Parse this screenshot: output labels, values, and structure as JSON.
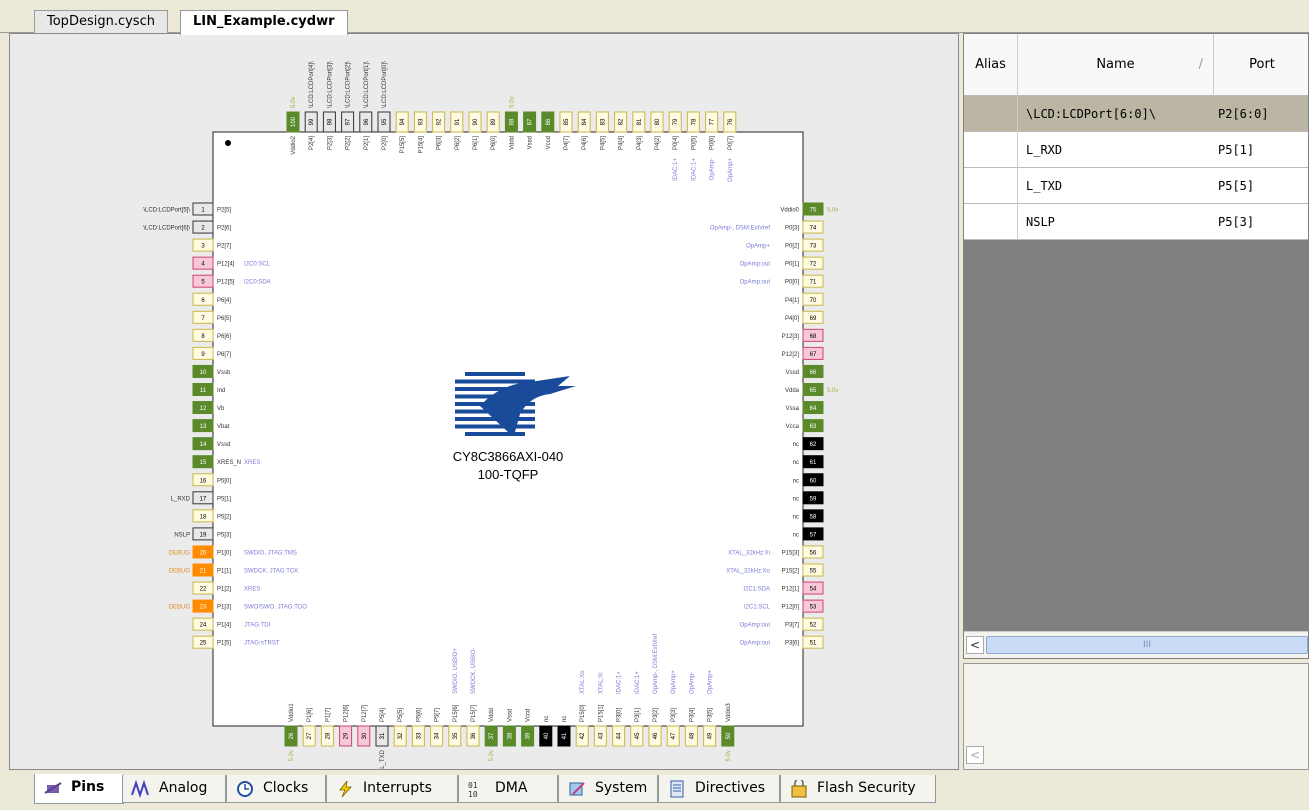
{
  "file_tabs": [
    {
      "label": "TopDesign.cysch"
    },
    {
      "label": "LIN_Example.cydwr"
    }
  ],
  "chip": {
    "part": "CY8C3866AXI-040",
    "package": "100-TQFP",
    "colors": {
      "plain": "#fffbe0",
      "plain_border": "#c9b74a",
      "supply": "#5a8a2a",
      "black": "#000000",
      "orange": "#ff8c00",
      "pink": "#f8c8d8",
      "pink_border": "#d0407a",
      "boxed": "#e8e8e8",
      "boxed_border": "#333333"
    }
  },
  "pins": {
    "left": [
      {
        "n": "1",
        "name": "P2[5]",
        "ext": "\\LCD:LCDPort[5]\\",
        "type": "boxed"
      },
      {
        "n": "2",
        "name": "P2[6]",
        "ext": "\\LCD:LCDPort[6]\\",
        "type": "boxed"
      },
      {
        "n": "3",
        "name": "P2[7]",
        "type": "plain"
      },
      {
        "n": "4",
        "name": "P12[4]",
        "fn": "I2C0:SCL",
        "type": "pink"
      },
      {
        "n": "5",
        "name": "P12[5]",
        "fn": "I2C0:SDA",
        "type": "pink"
      },
      {
        "n": "6",
        "name": "P6[4]",
        "type": "plain"
      },
      {
        "n": "7",
        "name": "P6[5]",
        "type": "plain"
      },
      {
        "n": "8",
        "name": "P6[6]",
        "type": "plain"
      },
      {
        "n": "9",
        "name": "P6[7]",
        "type": "plain"
      },
      {
        "n": "10",
        "name": "Vssb",
        "type": "supply"
      },
      {
        "n": "11",
        "name": "Ind",
        "type": "supply"
      },
      {
        "n": "12",
        "name": "Vb",
        "type": "supply"
      },
      {
        "n": "13",
        "name": "Vbat",
        "type": "supply"
      },
      {
        "n": "14",
        "name": "Vssd",
        "type": "supply"
      },
      {
        "n": "15",
        "name": "XRES_N",
        "fn": "XRES",
        "type": "supply"
      },
      {
        "n": "16",
        "name": "P5[0]",
        "type": "plain"
      },
      {
        "n": "17",
        "name": "P5[1]",
        "ext": "L_RXD",
        "type": "boxed"
      },
      {
        "n": "18",
        "name": "P5[2]",
        "type": "plain"
      },
      {
        "n": "19",
        "name": "P5[3]",
        "ext": "NSLP",
        "type": "boxed"
      },
      {
        "n": "20",
        "name": "P1[0]",
        "fn": "SWDIO, JTAG:TMS",
        "ext": "DEBUG",
        "type": "orange"
      },
      {
        "n": "21",
        "name": "P1[1]",
        "fn": "SWDCK, JTAG:TCK",
        "ext": "DEBUG",
        "type": "orange"
      },
      {
        "n": "22",
        "name": "P1[2]",
        "fn": "XRES",
        "type": "plain"
      },
      {
        "n": "23",
        "name": "P1[3]",
        "fn": "SWO/SWO, JTAG:TDO",
        "ext": "DEBUG",
        "type": "orange"
      },
      {
        "n": "24",
        "name": "P1[4]",
        "fn": "JTAG:TDI",
        "type": "plain"
      },
      {
        "n": "25",
        "name": "P1[5]",
        "fn": "JTAG:nTRST",
        "type": "plain"
      }
    ],
    "bottom": [
      {
        "n": "26",
        "name": "Vddio1",
        "type": "supply",
        "v": "5.0v"
      },
      {
        "n": "27",
        "name": "P1[6]",
        "type": "plain"
      },
      {
        "n": "28",
        "name": "P1[7]",
        "type": "plain"
      },
      {
        "n": "29",
        "name": "P12[6]",
        "type": "pink"
      },
      {
        "n": "30",
        "name": "P12[7]",
        "type": "pink"
      },
      {
        "n": "31",
        "name": "P5[4]",
        "type": "boxed",
        "ext": "L_TXD"
      },
      {
        "n": "32",
        "name": "P5[5]",
        "type": "plain"
      },
      {
        "n": "33",
        "name": "P5[6]",
        "type": "plain"
      },
      {
        "n": "34",
        "name": "P5[7]",
        "type": "plain"
      },
      {
        "n": "35",
        "name": "P15[6]",
        "fn": "SWDIO, USBIO+",
        "type": "plain"
      },
      {
        "n": "36",
        "name": "P15[7]",
        "fn": "SWDCK, USBIO-",
        "type": "plain"
      },
      {
        "n": "37",
        "name": "Vddd",
        "type": "supply",
        "v": "5.0v"
      },
      {
        "n": "38",
        "name": "Vssd",
        "type": "supply"
      },
      {
        "n": "39",
        "name": "Vccd",
        "type": "supply"
      },
      {
        "n": "40",
        "name": "nc",
        "type": "black"
      },
      {
        "n": "41",
        "name": "nc",
        "type": "black"
      },
      {
        "n": "42",
        "name": "P15[0]",
        "fn": "XTAL:Xo",
        "type": "plain"
      },
      {
        "n": "43",
        "name": "P15[1]",
        "fn": "XTAL:Xi",
        "type": "plain"
      },
      {
        "n": "44",
        "name": "P3[0]",
        "fn": "IDAC:1+",
        "type": "plain"
      },
      {
        "n": "45",
        "name": "P3[1]",
        "fn": "IDAC:1+",
        "type": "plain"
      },
      {
        "n": "46",
        "name": "P3[2]",
        "fn": "OpAmp-, DSM:ExtVref",
        "type": "plain"
      },
      {
        "n": "47",
        "name": "P3[3]",
        "fn": "OpAmp+",
        "type": "plain"
      },
      {
        "n": "48",
        "name": "P3[4]",
        "fn": "OpAmp-",
        "type": "plain"
      },
      {
        "n": "49",
        "name": "P3[5]",
        "fn": "OpAmp+",
        "type": "plain"
      },
      {
        "n": "50",
        "name": "Vddio3",
        "type": "supply",
        "v": "5.0v"
      }
    ],
    "right": [
      {
        "n": "75",
        "name": "Vddio0",
        "type": "supply",
        "v": "5.0v"
      },
      {
        "n": "74",
        "name": "P0[3]",
        "fn": "OpAmp-, DSM:ExtVref",
        "type": "plain"
      },
      {
        "n": "73",
        "name": "P0[2]",
        "fn": "OpAmp+",
        "type": "plain"
      },
      {
        "n": "72",
        "name": "P0[1]",
        "fn": "OpAmp:out",
        "type": "plain"
      },
      {
        "n": "71",
        "name": "P0[0]",
        "fn": "OpAmp:out",
        "type": "plain"
      },
      {
        "n": "70",
        "name": "P4[1]",
        "type": "plain"
      },
      {
        "n": "69",
        "name": "P4[0]",
        "type": "plain"
      },
      {
        "n": "68",
        "name": "P12[3]",
        "type": "pink"
      },
      {
        "n": "67",
        "name": "P12[2]",
        "type": "pink"
      },
      {
        "n": "66",
        "name": "Vssd",
        "type": "supply"
      },
      {
        "n": "65",
        "name": "Vdda",
        "type": "supply",
        "v": "5.0v"
      },
      {
        "n": "64",
        "name": "Vssa",
        "type": "supply"
      },
      {
        "n": "63",
        "name": "Vcca",
        "type": "supply"
      },
      {
        "n": "62",
        "name": "nc",
        "type": "black"
      },
      {
        "n": "61",
        "name": "nc",
        "type": "black"
      },
      {
        "n": "60",
        "name": "nc",
        "type": "black"
      },
      {
        "n": "59",
        "name": "nc",
        "type": "black"
      },
      {
        "n": "58",
        "name": "nc",
        "type": "black"
      },
      {
        "n": "57",
        "name": "nc",
        "type": "black"
      },
      {
        "n": "56",
        "name": "P15[3]",
        "fn": "XTAL_32kHz:Xi",
        "type": "plain"
      },
      {
        "n": "55",
        "name": "P15[2]",
        "fn": "XTAL_32kHz:Xo",
        "type": "plain"
      },
      {
        "n": "54",
        "name": "P12[1]",
        "fn": "I2C1:SDA",
        "type": "pink"
      },
      {
        "n": "53",
        "name": "P12[0]",
        "fn": "I2C1:SCL",
        "type": "pink"
      },
      {
        "n": "52",
        "name": "P3[7]",
        "fn": "OpAmp:out",
        "type": "plain"
      },
      {
        "n": "51",
        "name": "P3[6]",
        "fn": "OpAmp:out",
        "type": "plain"
      }
    ],
    "top": [
      {
        "n": "100",
        "name": "Vddio2",
        "type": "supply",
        "v": "5.0v"
      },
      {
        "n": "99",
        "name": "P2[4]",
        "type": "boxed",
        "ext": "\\LCD:LCDPort[4]\\"
      },
      {
        "n": "98",
        "name": "P2[3]",
        "type": "boxed",
        "ext": "\\LCD:LCDPort[3]\\"
      },
      {
        "n": "97",
        "name": "P2[2]",
        "type": "boxed",
        "ext": "\\LCD:LCDPort[2]\\"
      },
      {
        "n": "96",
        "name": "P2[1]",
        "type": "boxed",
        "ext": "\\LCD:LCDPort[1]\\"
      },
      {
        "n": "95",
        "name": "P2[0]",
        "type": "boxed",
        "ext": "\\LCD:LCDPort[0]\\"
      },
      {
        "n": "94",
        "name": "P15[5]",
        "type": "plain"
      },
      {
        "n": "93",
        "name": "P15[4]",
        "type": "plain"
      },
      {
        "n": "92",
        "name": "P6[3]",
        "type": "plain"
      },
      {
        "n": "91",
        "name": "P6[2]",
        "type": "plain"
      },
      {
        "n": "90",
        "name": "P6[1]",
        "type": "plain"
      },
      {
        "n": "89",
        "name": "P6[0]",
        "type": "plain"
      },
      {
        "n": "88",
        "name": "Vddd",
        "type": "supply",
        "v": "5.0v"
      },
      {
        "n": "87",
        "name": "Vssd",
        "type": "supply"
      },
      {
        "n": "86",
        "name": "Vccd",
        "type": "supply"
      },
      {
        "n": "85",
        "name": "P4[7]",
        "type": "plain"
      },
      {
        "n": "84",
        "name": "P4[6]",
        "type": "plain"
      },
      {
        "n": "83",
        "name": "P4[5]",
        "type": "plain"
      },
      {
        "n": "82",
        "name": "P4[4]",
        "type": "plain"
      },
      {
        "n": "81",
        "name": "P4[3]",
        "type": "plain"
      },
      {
        "n": "80",
        "name": "P4[2]",
        "type": "plain"
      },
      {
        "n": "79",
        "name": "P0[4]",
        "fn": "IDAC:1+",
        "type": "plain"
      },
      {
        "n": "78",
        "name": "P0[5]",
        "fn": "IDAC:1+",
        "type": "plain"
      },
      {
        "n": "77",
        "name": "P0[6]",
        "fn": "OpAmp-",
        "type": "plain"
      },
      {
        "n": "76",
        "name": "P0[7]",
        "fn": "OpAmp+",
        "type": "plain"
      }
    ]
  },
  "table": {
    "headers": {
      "alias": "Alias",
      "name": "Name",
      "sort": "/",
      "port": "Port"
    },
    "rows": [
      {
        "name": "\\LCD:LCDPort[6:0]\\",
        "port": "P2[6:0]",
        "selected": true
      },
      {
        "name": "L_RXD",
        "port": "P5[1]",
        "selected": false
      },
      {
        "name": "L_TXD",
        "port": "P5[5]",
        "selected": false
      },
      {
        "name": "NSLP",
        "port": "P5[3]",
        "selected": false
      }
    ],
    "scroll_left": "<",
    "scroll_grip": "III"
  },
  "scroll2_left": "<",
  "bottom_tabs": [
    {
      "label": "Pins",
      "icon": "pins-icon",
      "active": true
    },
    {
      "label": "Analog",
      "icon": "analog-icon"
    },
    {
      "label": "Clocks",
      "icon": "clock-icon"
    },
    {
      "label": "Interrupts",
      "icon": "interrupt-icon"
    },
    {
      "label": "DMA",
      "icon": "dma-icon"
    },
    {
      "label": "System",
      "icon": "system-icon"
    },
    {
      "label": "Directives",
      "icon": "directives-icon"
    },
    {
      "label": "Flash Security",
      "icon": "flash-security-icon"
    }
  ]
}
